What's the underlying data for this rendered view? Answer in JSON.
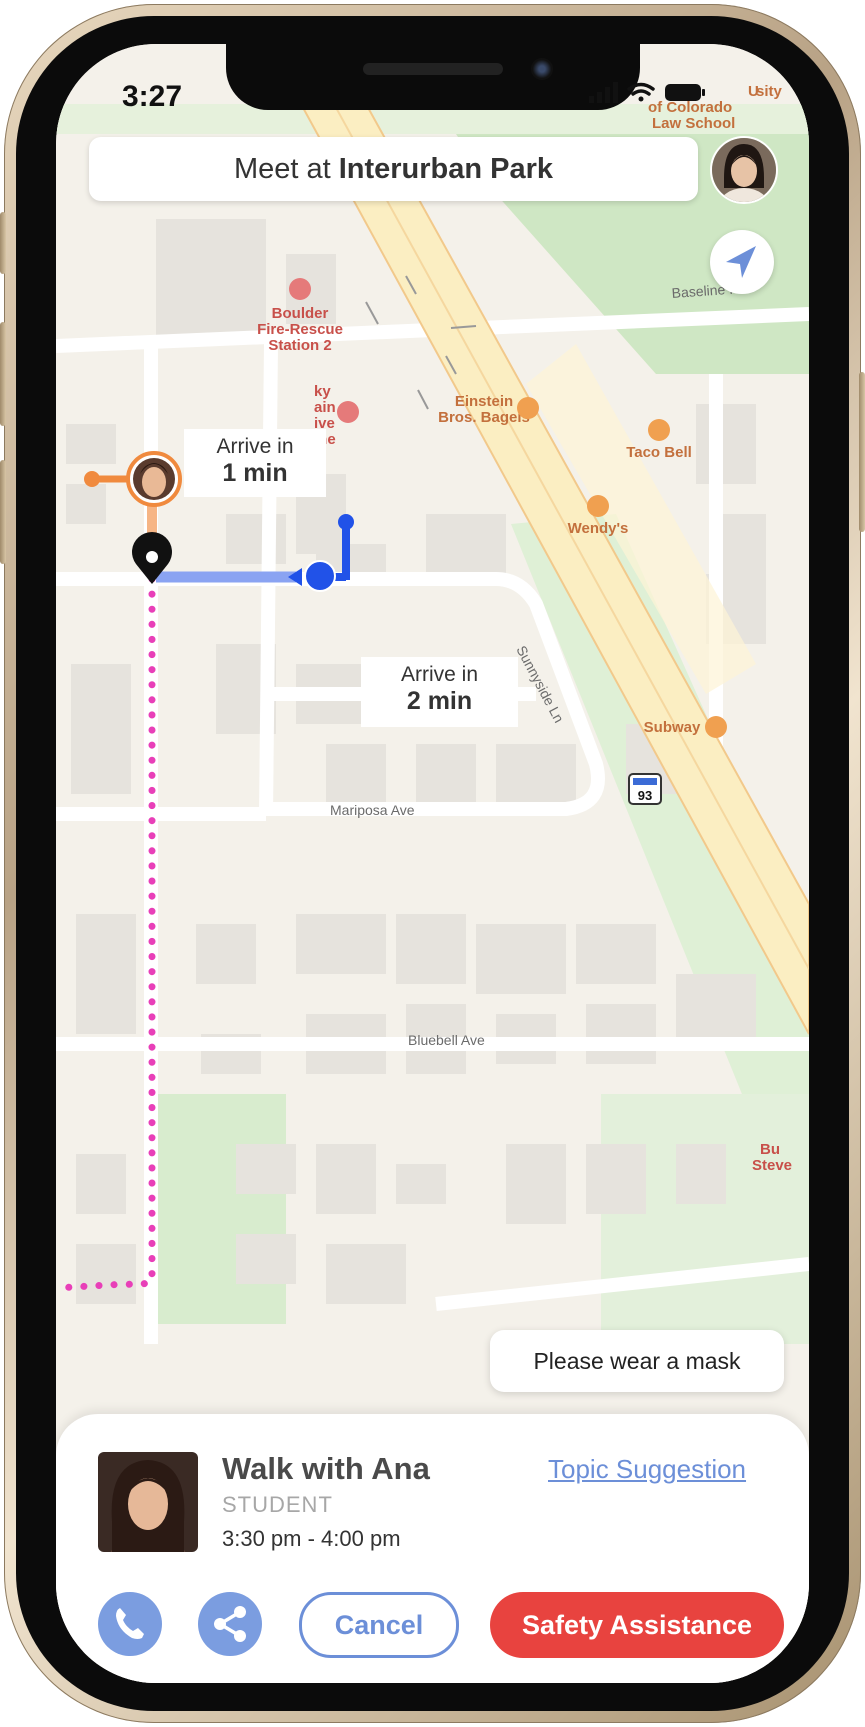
{
  "status_bar": {
    "time": "3:27"
  },
  "header": {
    "meet_prefix": "Meet at",
    "meet_place": "Interurban Park"
  },
  "map": {
    "streets": [
      "Baseline Rd",
      "Sunnyside Ln",
      "Mariposa Ave",
      "Bluebell Ave"
    ],
    "pois": [
      "Boulder Fire-Rescue Station 2",
      "Einstein Bros. Bagels",
      "Taco Bell",
      "Wendy's",
      "Subway"
    ],
    "poi_lines": {
      "fire": [
        "Boulder",
        "Fire-Rescue",
        "Station 2"
      ],
      "einstein": [
        "Einstein",
        "Bros. Bagels"
      ],
      "lucky": [
        "ky",
        "ain",
        "ive",
        "ine"
      ],
      "univ": [
        "U",
        "sity",
        "of Colorado",
        "Law School"
      ],
      "burger": [
        "Bu",
        "Steve"
      ]
    },
    "highway_shield": "93",
    "eta_1": {
      "label": "Arrive in",
      "time": "1 min"
    },
    "eta_2": {
      "label": "Arrive in",
      "time": "2 min"
    },
    "colors": {
      "orange_route": "#f08a3e",
      "blue_route": "#2152e8",
      "pink_route": "#e83fb8"
    }
  },
  "notice": {
    "text": "Please wear a mask"
  },
  "walk": {
    "title": "Walk with Ana",
    "role": "STUDENT",
    "time": "3:30 pm - 4:00 pm",
    "topic_link": "Topic Suggestion"
  },
  "actions": {
    "cancel": "Cancel",
    "safety": "Safety Assistance",
    "call_icon": "phone-icon",
    "share_icon": "share-icon"
  },
  "colors": {
    "accent": "#7b9de0",
    "danger": "#e8433f"
  }
}
